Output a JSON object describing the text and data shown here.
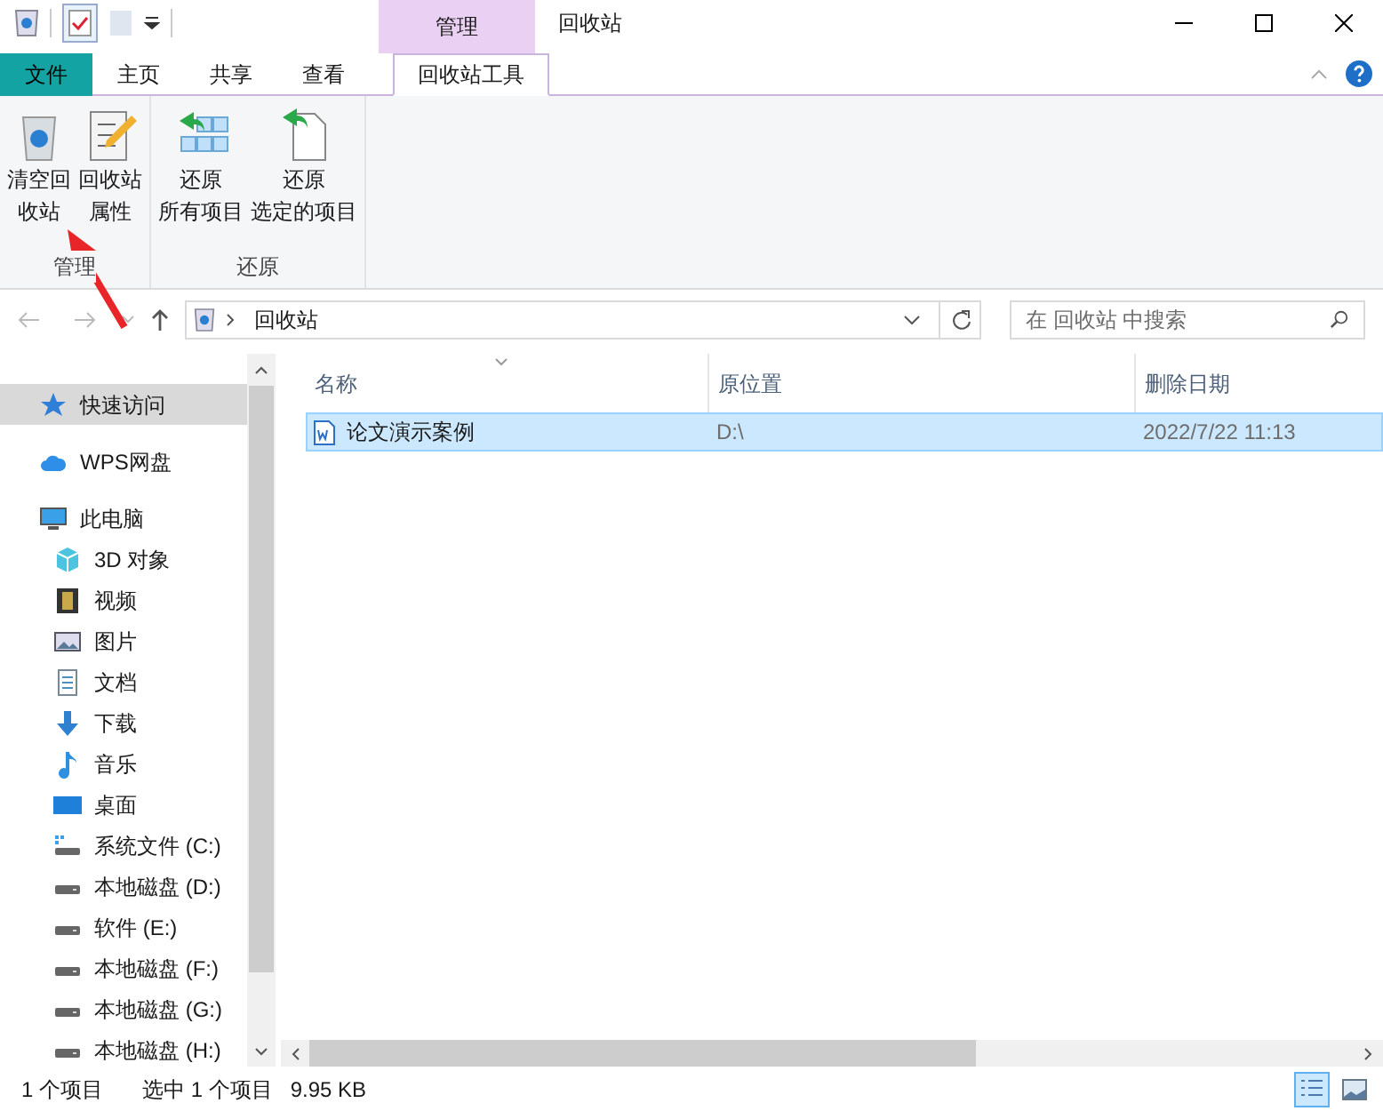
{
  "window": {
    "title": "回收站",
    "context_tab_header": "管理"
  },
  "ribbon_tabs": [
    {
      "label": "文件",
      "kind": "file",
      "selected": false
    },
    {
      "label": "主页",
      "kind": "tab",
      "selected": false
    },
    {
      "label": "共享",
      "kind": "tab",
      "selected": false
    },
    {
      "label": "查看",
      "kind": "tab",
      "selected": false
    },
    {
      "label": "回收站工具",
      "kind": "context",
      "selected": true
    }
  ],
  "ribbon_groups": [
    {
      "label": "管理",
      "buttons": [
        {
          "lines": [
            "清空回",
            "收站"
          ],
          "kind": "empty-bin"
        },
        {
          "lines": [
            "回收站",
            "属性"
          ],
          "kind": "properties"
        }
      ]
    },
    {
      "label": "还原",
      "buttons": [
        {
          "lines": [
            "还原",
            "所有项目"
          ],
          "kind": "restore-all"
        },
        {
          "lines": [
            "还原",
            "选定的项目"
          ],
          "kind": "restore-selected"
        }
      ]
    }
  ],
  "address_bar": {
    "path": "回收站"
  },
  "search": {
    "placeholder": "在 回收站 中搜索"
  },
  "navigation": [
    {
      "label": "快速访问",
      "kind": "star",
      "selected": true
    },
    {
      "label": "WPS网盘",
      "kind": "cloud",
      "selected": false
    },
    {
      "label": "此电脑",
      "kind": "pc",
      "selected": false,
      "children": [
        {
          "label": "3D 对象",
          "kind": "cube",
          "selected": false
        },
        {
          "label": "视频",
          "kind": "film",
          "selected": false
        },
        {
          "label": "图片",
          "kind": "picture",
          "selected": false
        },
        {
          "label": "文档",
          "kind": "document",
          "selected": false
        },
        {
          "label": "下载",
          "kind": "download",
          "selected": false
        },
        {
          "label": "音乐",
          "kind": "music",
          "selected": false
        },
        {
          "label": "桌面",
          "kind": "desktop",
          "selected": false
        },
        {
          "label": "系统文件 (C:)",
          "kind": "system-drive",
          "selected": false
        },
        {
          "label": "本地磁盘 (D:)",
          "kind": "drive",
          "selected": false
        },
        {
          "label": "软件 (E:)",
          "kind": "drive",
          "selected": false
        },
        {
          "label": "本地磁盘 (F:)",
          "kind": "drive",
          "selected": false
        },
        {
          "label": "本地磁盘 (G:)",
          "kind": "drive",
          "selected": false
        },
        {
          "label": "本地磁盘 (H:)",
          "kind": "drive",
          "selected": false
        }
      ]
    }
  ],
  "table": {
    "columns": [
      "名称",
      "原位置",
      "删除日期"
    ],
    "rows": [
      {
        "name": "论文演示案例",
        "location": "D:\\",
        "deleted": "2022/7/22 11:13",
        "selected": true
      }
    ]
  },
  "status_bar": {
    "item_count": "1 个项目",
    "selection": "选中 1 个项目",
    "size": "9.95 KB"
  },
  "view_buttons": [
    {
      "kind": "details",
      "selected": true
    },
    {
      "kind": "large-icons",
      "selected": false
    }
  ]
}
